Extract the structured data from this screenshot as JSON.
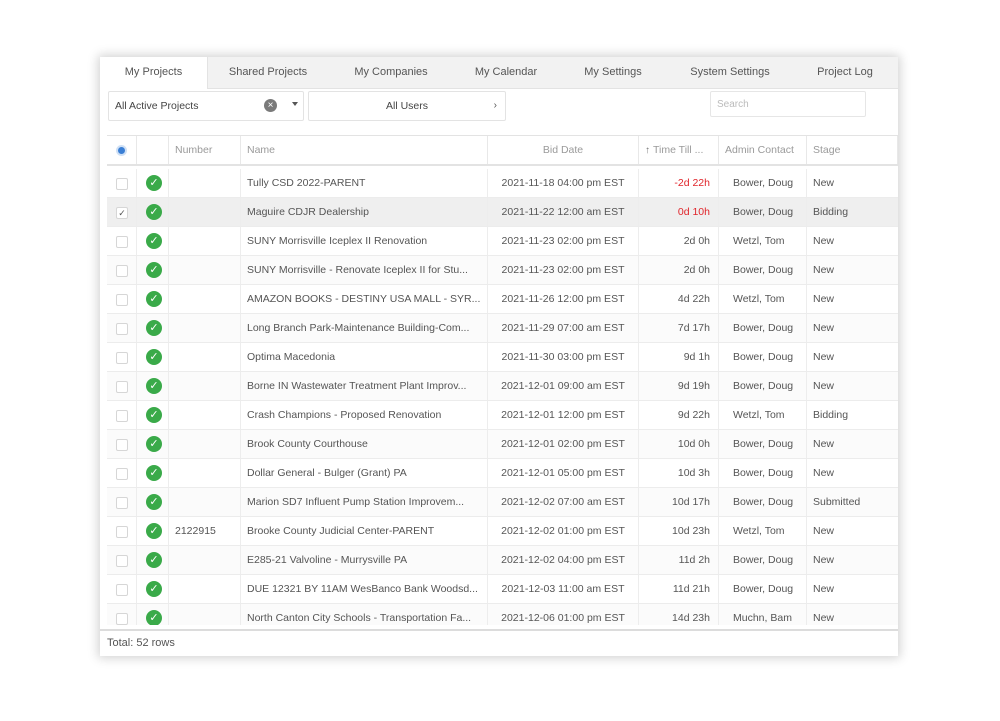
{
  "tabs": [
    {
      "label": "My Projects",
      "active": true
    },
    {
      "label": "Shared Projects",
      "active": false
    },
    {
      "label": "My Companies",
      "active": false
    },
    {
      "label": "My Calendar",
      "active": false
    },
    {
      "label": "My Settings",
      "active": false
    },
    {
      "label": "System Settings",
      "active": false
    },
    {
      "label": "Project Log",
      "active": false
    }
  ],
  "filters": {
    "project_filter": "All Active Projects",
    "users_filter": "All Users",
    "search_placeholder": "Search"
  },
  "columns": {
    "number": "Number",
    "name": "Name",
    "bid_date": "Bid Date",
    "time_till": "Time Till ...",
    "admin_contact": "Admin Contact",
    "stage": "Stage"
  },
  "rows": [
    {
      "checked": false,
      "number": "",
      "name": "Tully CSD 2022-PARENT",
      "bid_date": "2021-11-18 04:00 pm EST",
      "time_till": "-2d 22h",
      "overdue": true,
      "contact": "Bower, Doug",
      "stage": "New"
    },
    {
      "checked": true,
      "number": "",
      "name": "Maguire CDJR Dealership",
      "bid_date": "2021-11-22 12:00 am EST",
      "time_till": "0d 10h",
      "overdue": true,
      "contact": "Bower, Doug",
      "stage": "Bidding"
    },
    {
      "checked": false,
      "number": "",
      "name": "SUNY Morrisville Iceplex II Renovation",
      "bid_date": "2021-11-23 02:00 pm EST",
      "time_till": "2d 0h",
      "overdue": false,
      "contact": "Wetzl, Tom",
      "stage": "New"
    },
    {
      "checked": false,
      "number": "",
      "name": "SUNY Morrisville - Renovate Iceplex II for Stu...",
      "bid_date": "2021-11-23 02:00 pm EST",
      "time_till": "2d 0h",
      "overdue": false,
      "contact": "Bower, Doug",
      "stage": "New"
    },
    {
      "checked": false,
      "number": "",
      "name": "AMAZON BOOKS - DESTINY USA MALL - SYR...",
      "bid_date": "2021-11-26 12:00 pm EST",
      "time_till": "4d 22h",
      "overdue": false,
      "contact": "Wetzl, Tom",
      "stage": "New"
    },
    {
      "checked": false,
      "number": "",
      "name": "Long Branch Park-Maintenance Building-Com...",
      "bid_date": "2021-11-29 07:00 am EST",
      "time_till": "7d 17h",
      "overdue": false,
      "contact": "Bower, Doug",
      "stage": "New"
    },
    {
      "checked": false,
      "number": "",
      "name": "Optima Macedonia",
      "bid_date": "2021-11-30 03:00 pm EST",
      "time_till": "9d 1h",
      "overdue": false,
      "contact": "Bower, Doug",
      "stage": "New"
    },
    {
      "checked": false,
      "number": "",
      "name": "Borne IN Wastewater Treatment Plant Improv...",
      "bid_date": "2021-12-01 09:00 am EST",
      "time_till": "9d 19h",
      "overdue": false,
      "contact": "Bower, Doug",
      "stage": "New"
    },
    {
      "checked": false,
      "number": "",
      "name": "Crash Champions - Proposed Renovation",
      "bid_date": "2021-12-01 12:00 pm EST",
      "time_till": "9d 22h",
      "overdue": false,
      "contact": "Wetzl, Tom",
      "stage": "Bidding"
    },
    {
      "checked": false,
      "number": "",
      "name": "Brook County Courthouse",
      "bid_date": "2021-12-01 02:00 pm EST",
      "time_till": "10d 0h",
      "overdue": false,
      "contact": "Bower, Doug",
      "stage": "New"
    },
    {
      "checked": false,
      "number": "",
      "name": "Dollar General - Bulger (Grant) PA",
      "bid_date": "2021-12-01 05:00 pm EST",
      "time_till": "10d 3h",
      "overdue": false,
      "contact": "Bower, Doug",
      "stage": "New"
    },
    {
      "checked": false,
      "number": "",
      "name": "Marion SD7 Influent Pump Station Improvem...",
      "bid_date": "2021-12-02 07:00 am EST",
      "time_till": "10d 17h",
      "overdue": false,
      "contact": "Bower, Doug",
      "stage": "Submitted"
    },
    {
      "checked": false,
      "number": "2122915",
      "name": "Brooke County Judicial Center-PARENT",
      "bid_date": "2021-12-02 01:00 pm EST",
      "time_till": "10d 23h",
      "overdue": false,
      "contact": "Wetzl, Tom",
      "stage": "New"
    },
    {
      "checked": false,
      "number": "",
      "name": "E285-21 Valvoline - Murrysville PA",
      "bid_date": "2021-12-02 04:00 pm EST",
      "time_till": "11d 2h",
      "overdue": false,
      "contact": "Bower, Doug",
      "stage": "New"
    },
    {
      "checked": false,
      "number": "",
      "name": "DUE 12321 BY 11AM WesBanco Bank Woodsd...",
      "bid_date": "2021-12-03 11:00 am EST",
      "time_till": "11d 21h",
      "overdue": false,
      "contact": "Bower, Doug",
      "stage": "New"
    },
    {
      "checked": false,
      "number": "",
      "name": "North Canton City Schools - Transportation Fa...",
      "bid_date": "2021-12-06 01:00 pm EST",
      "time_till": "14d 23h",
      "overdue": false,
      "contact": "Muchn, Bam",
      "stage": "New"
    }
  ],
  "footer": {
    "total": "Total: 52 rows"
  },
  "colors": {
    "accent": "#3a7fd5",
    "ok": "#3aaa49",
    "overdue": "#e0252b"
  }
}
